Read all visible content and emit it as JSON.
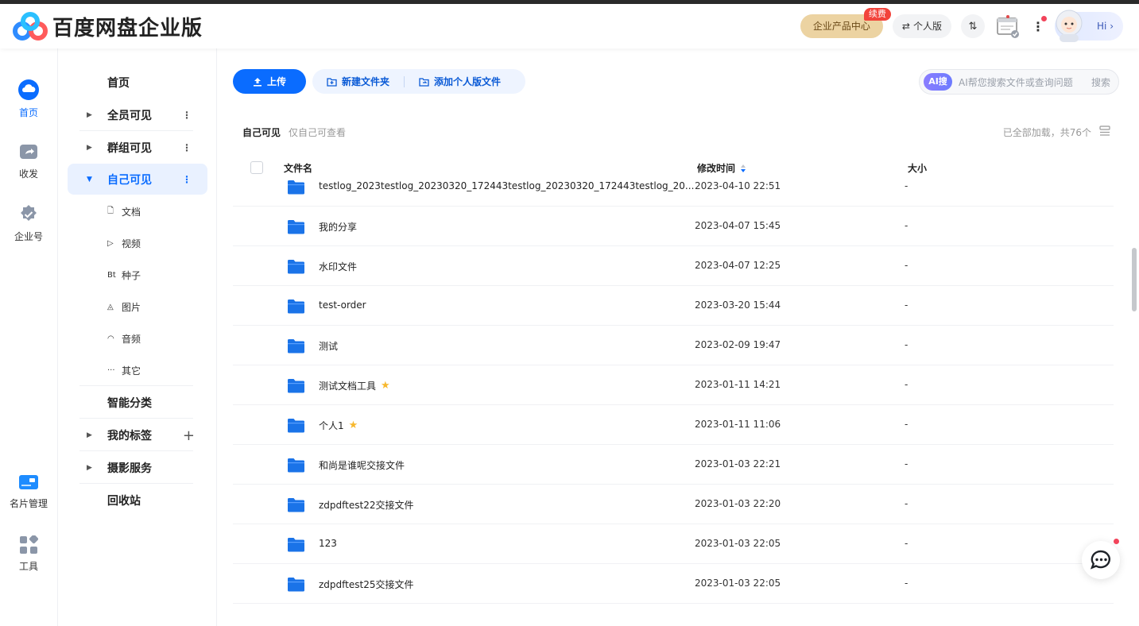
{
  "app": {
    "title": "百度网盘企业版"
  },
  "header": {
    "product_center": "企业产品中心",
    "renew_badge": "续费",
    "personal_edition": "个人版",
    "transfer_icon": "transfer-icon",
    "hi": "Hi"
  },
  "rail": [
    {
      "label": "首页",
      "icon": "cloud-icon",
      "active": true
    },
    {
      "label": "收发",
      "icon": "share-icon"
    },
    {
      "label": "企业号",
      "icon": "verified-icon"
    },
    {
      "label": "名片管理",
      "icon": "card-icon"
    },
    {
      "label": "工具",
      "icon": "tools-icon"
    }
  ],
  "sidebar": {
    "home": "首页",
    "all_visible": "全员可见",
    "group_visible": "群组可见",
    "self_visible": "自己可见",
    "subs": [
      {
        "icon_text": "🗋",
        "label": "文档"
      },
      {
        "icon_text": "▷",
        "label": "视频"
      },
      {
        "icon_text": "Bt",
        "label": "种子"
      },
      {
        "icon_text": "◬",
        "label": "图片"
      },
      {
        "icon_text": "◠",
        "label": "音频"
      },
      {
        "icon_text": "···",
        "label": "其它"
      }
    ],
    "smart_category": "智能分类",
    "my_tags": "我的标签",
    "photo_service": "摄影服务",
    "recycle_bin": "回收站"
  },
  "toolbar": {
    "upload": "上传",
    "new_folder": "新建文件夹",
    "add_personal": "添加个人版文件",
    "ai_badge": "AI搜",
    "search_placeholder": "AI帮您搜索文件或查询问题",
    "search_button": "搜索"
  },
  "breadcrumb": {
    "current": "自己可见",
    "hint": "仅自己可查看"
  },
  "loaded_text": "已全部加载，共76个",
  "table": {
    "col_name": "文件名",
    "col_time": "修改时间",
    "col_size": "大小",
    "rows": [
      {
        "name": "testlog_2023testlog_20230320_172443testlog_20230320_172443testlog_20...",
        "time": "2023-04-10 22:51",
        "size": "-",
        "starred": false
      },
      {
        "name": "我的分享",
        "time": "2023-04-07 15:45",
        "size": "-",
        "starred": false
      },
      {
        "name": "水印文件",
        "time": "2023-04-07 12:25",
        "size": "-",
        "starred": false
      },
      {
        "name": "test-order",
        "time": "2023-03-20 15:44",
        "size": "-",
        "starred": false
      },
      {
        "name": "测试",
        "time": "2023-02-09 19:47",
        "size": "-",
        "starred": false
      },
      {
        "name": "测试文档工具",
        "time": "2023-01-11 14:21",
        "size": "-",
        "starred": true
      },
      {
        "name": "个人1",
        "time": "2023-01-11 11:06",
        "size": "-",
        "starred": true
      },
      {
        "name": "和尚是谁呢交接文件",
        "time": "2023-01-03 22:21",
        "size": "-",
        "starred": false
      },
      {
        "name": "zdpdftest22交接文件",
        "time": "2023-01-03 22:20",
        "size": "-",
        "starred": false
      },
      {
        "name": "123",
        "time": "2023-01-03 22:05",
        "size": "-",
        "starred": false
      },
      {
        "name": "zdpdftest25交接文件",
        "time": "2023-01-03 22:05",
        "size": "-",
        "starred": false
      }
    ]
  },
  "colors": {
    "accent": "#0a6cff",
    "folder": "#1a73e8",
    "star": "#f7b82d"
  }
}
